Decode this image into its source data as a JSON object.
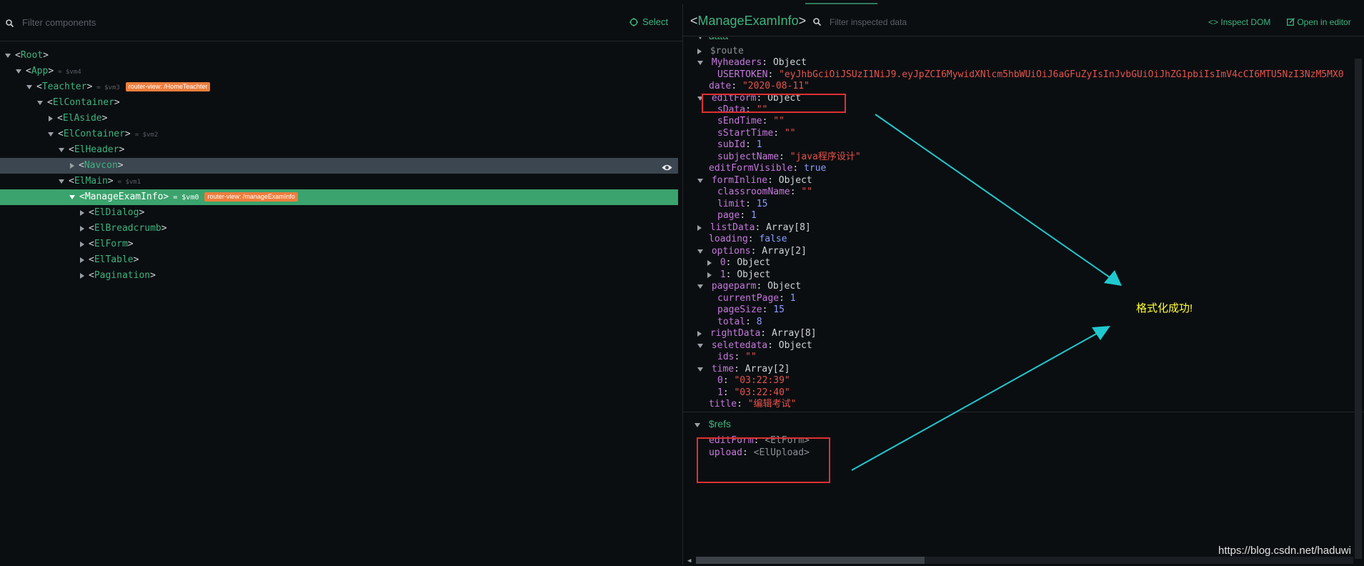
{
  "left_panel": {
    "filter_placeholder": "Filter components",
    "select_label": "Select",
    "tree": [
      {
        "ang_open": "<",
        "name": "Root",
        "ang_close": ">",
        "vm": "",
        "badge": ""
      },
      {
        "ang_open": "<",
        "name": "App",
        "ang_close": ">",
        "vm": "= $vm4",
        "badge": ""
      },
      {
        "ang_open": "<",
        "name": "Teachter",
        "ang_close": ">",
        "vm": "= $vm3",
        "badge": "router-view: /HomeTeachter"
      },
      {
        "ang_open": "<",
        "name": "ElContainer",
        "ang_close": ">",
        "vm": "",
        "badge": ""
      },
      {
        "ang_open": "<",
        "name": "ElAside",
        "ang_close": ">",
        "vm": "",
        "badge": ""
      },
      {
        "ang_open": "<",
        "name": "ElContainer",
        "ang_close": ">",
        "vm": "= $vm2",
        "badge": ""
      },
      {
        "ang_open": "<",
        "name": "ElHeader",
        "ang_close": ">",
        "vm": "",
        "badge": ""
      },
      {
        "ang_open": "<",
        "name": "Navcon",
        "ang_close": ">",
        "vm": "",
        "badge": ""
      },
      {
        "ang_open": "<",
        "name": "ElMain",
        "ang_close": ">",
        "vm": "= $vm1",
        "badge": ""
      },
      {
        "ang_open": "<",
        "name": "ManageExamInfo",
        "ang_close": ">",
        "vm": "= $vm0",
        "badge": "router-view: /manageExamInfo"
      },
      {
        "ang_open": "<",
        "name": "ElDialog",
        "ang_close": ">",
        "vm": "",
        "badge": ""
      },
      {
        "ang_open": "<",
        "name": "ElBreadcrumb",
        "ang_close": ">",
        "vm": "",
        "badge": ""
      },
      {
        "ang_open": "<",
        "name": "ElForm",
        "ang_close": ">",
        "vm": "",
        "badge": ""
      },
      {
        "ang_open": "<",
        "name": "ElTable",
        "ang_close": ">",
        "vm": "",
        "badge": ""
      },
      {
        "ang_open": "<",
        "name": "Pagination",
        "ang_close": ">",
        "vm": "",
        "badge": ""
      }
    ]
  },
  "right_panel": {
    "title_open": "<",
    "title_name": "ManageExamInfo",
    "title_close": ">",
    "filter_placeholder": "Filter inspected data",
    "inspect_dom": "Inspect DOM",
    "open_in_editor": "Open in editor",
    "data_section": "data",
    "refs_section": "$refs",
    "props": [
      {
        "key": "$route",
        "value": "",
        "type": "obj"
      },
      {
        "key": "Myheaders",
        "value": "Object",
        "type": "obj"
      },
      {
        "key": "USERTOKEN",
        "value": "\"eyJhbGciOiJSUzI1NiJ9.eyJpZCI6MywidXNlcm5hbWUiOiJ6aGFuZyIsInJvbGUiOiJhZG1pbiIsImV4cCI6MTU5NzI3NzM5MX0",
        "type": "str"
      },
      {
        "key": "date",
        "value": "\"2020-08-11\"",
        "type": "str"
      },
      {
        "key": "editForm",
        "value": "Object",
        "type": "obj"
      },
      {
        "key": "sData",
        "value": "\"\"",
        "type": "str"
      },
      {
        "key": "sEndTime",
        "value": "\"\"",
        "type": "str"
      },
      {
        "key": "sStartTime",
        "value": "\"\"",
        "type": "str"
      },
      {
        "key": "subId",
        "value": "1",
        "type": "num"
      },
      {
        "key": "subjectName",
        "value": "\"java程序设计\"",
        "type": "str"
      },
      {
        "key": "editFormVisible",
        "value": "true",
        "type": "bool"
      },
      {
        "key": "formInline",
        "value": "Object",
        "type": "obj"
      },
      {
        "key": "classroomName",
        "value": "\"\"",
        "type": "str"
      },
      {
        "key": "limit",
        "value": "15",
        "type": "num"
      },
      {
        "key": "page",
        "value": "1",
        "type": "num"
      },
      {
        "key": "listData",
        "value": "Array[8]",
        "type": "obj"
      },
      {
        "key": "loading",
        "value": "false",
        "type": "bool"
      },
      {
        "key": "options",
        "value": "Array[2]",
        "type": "obj"
      },
      {
        "key": "0",
        "value": "Object",
        "type": "obj"
      },
      {
        "key": "1",
        "value": "Object",
        "type": "obj"
      },
      {
        "key": "pageparm",
        "value": "Object",
        "type": "obj"
      },
      {
        "key": "currentPage",
        "value": "1",
        "type": "num"
      },
      {
        "key": "pageSize",
        "value": "15",
        "type": "num"
      },
      {
        "key": "total",
        "value": "8",
        "type": "num"
      },
      {
        "key": "rightData",
        "value": "Array[8]",
        "type": "obj"
      },
      {
        "key": "seletedata",
        "value": "Object",
        "type": "obj"
      },
      {
        "key": "ids",
        "value": "\"\"",
        "type": "str"
      },
      {
        "key": "time",
        "value": "Array[2]",
        "type": "obj"
      },
      {
        "key": "0",
        "value": "\"03:22:39\"",
        "type": "str"
      },
      {
        "key": "1",
        "value": "\"03:22:40\"",
        "type": "str"
      },
      {
        "key": "title",
        "value": "\"编辑考试\"",
        "type": "str"
      }
    ],
    "refs": [
      {
        "key": "editForm",
        "value": "<ElForm>"
      },
      {
        "key": "upload",
        "value": "<ElUpload>"
      }
    ]
  },
  "annotation": "格式化成功!",
  "watermark": "https://blog.csdn.net/haduwi",
  "colors": {
    "accent": "#3db37f",
    "badge": "#ee7d3c",
    "highlight_box": "#e03030",
    "arrow": "#1fc9cf",
    "annotation": "#ffff33"
  }
}
